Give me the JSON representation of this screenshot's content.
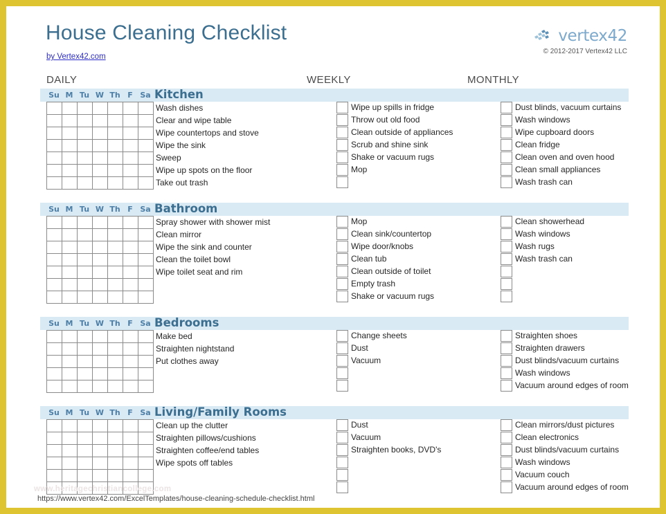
{
  "header": {
    "title": "House Cleaning Checklist",
    "byline": "by Vertex42.com",
    "brand_name": "vertex42",
    "brand_mark_icon": "vertex42-chevrons-icon",
    "copyright": "© 2012-2017 Vertex42 LLC"
  },
  "columns": {
    "daily": "DAILY",
    "weekly": "WEEKLY",
    "monthly": "MONTHLY"
  },
  "days": [
    "Su",
    "M",
    "Tu",
    "W",
    "Th",
    "F",
    "Sa"
  ],
  "colors": {
    "page_border": "#dfc431",
    "section_bar": "#daeaf5",
    "title_blue": "#3b6e8f",
    "day_label_blue": "#4d7fa6",
    "link_blue": "#2c2cc8",
    "brand_blue": "#7ca9cc",
    "cell_border": "#8a8a8a"
  },
  "sections": [
    {
      "name": "Kitchen",
      "daily_rows": 7,
      "daily": [
        "Wash dishes",
        "Clear and wipe table",
        "Wipe countertops and stove",
        "Wipe the sink",
        "Sweep",
        "Wipe up spots on the floor",
        "Take out trash"
      ],
      "weekly_rows": 7,
      "weekly": [
        "Wipe up spills in fridge",
        "Throw out old food",
        "Clean outside of appliances",
        "Scrub and shine sink",
        "Shake or vacuum rugs",
        "Mop",
        ""
      ],
      "monthly_rows": 7,
      "monthly": [
        "Dust blinds, vacuum curtains",
        "Wash windows",
        "Wipe cupboard doors",
        "Clean fridge",
        "Clean oven and oven hood",
        "Clean small appliances",
        "Wash trash can"
      ]
    },
    {
      "name": "Bathroom",
      "daily_rows": 7,
      "daily": [
        "Spray shower with shower mist",
        "Clean mirror",
        "Wipe the sink and counter",
        "Clean the toilet bowl",
        "Wipe toilet seat and rim",
        "",
        ""
      ],
      "weekly_rows": 7,
      "weekly": [
        "Mop",
        "Clean sink/countertop",
        "Wipe door/knobs",
        "Clean tub",
        "Clean outside of toilet",
        "Empty trash",
        "Shake or vacuum rugs"
      ],
      "monthly_rows": 7,
      "monthly": [
        "Clean showerhead",
        "Wash windows",
        "Wash rugs",
        "Wash trash can",
        "",
        "",
        ""
      ]
    },
    {
      "name": "Bedrooms",
      "daily_rows": 5,
      "daily": [
        "Make bed",
        "Straighten nightstand",
        "Put clothes away",
        "",
        ""
      ],
      "weekly_rows": 5,
      "weekly": [
        "Change sheets",
        "Dust",
        "Vacuum",
        "",
        ""
      ],
      "monthly_rows": 5,
      "monthly": [
        "Straighten shoes",
        "Straighten drawers",
        "Dust blinds/vacuum curtains",
        "Wash windows",
        "Vacuum around edges of room"
      ]
    },
    {
      "name": "Living/Family Rooms",
      "daily_rows": 6,
      "daily": [
        "Clean up the clutter",
        "Straighten pillows/cushions",
        "Straighten coffee/end tables",
        "Wipe spots off tables",
        "",
        ""
      ],
      "weekly_rows": 6,
      "weekly": [
        "Dust",
        "Vacuum",
        "Straighten books, DVD's",
        "",
        "",
        ""
      ],
      "monthly_rows": 6,
      "monthly": [
        "Clean mirrors/dust pictures",
        "Clean electronics",
        "Dust blinds/vacuum curtains",
        "Wash windows",
        "Vacuum couch",
        "Vacuum around edges of room"
      ]
    }
  ],
  "footer": {
    "watermark": "www.heritagechristiancollege.com",
    "url": "https://www.vertex42.com/ExcelTemplates/house-cleaning-schedule-checklist.html"
  }
}
